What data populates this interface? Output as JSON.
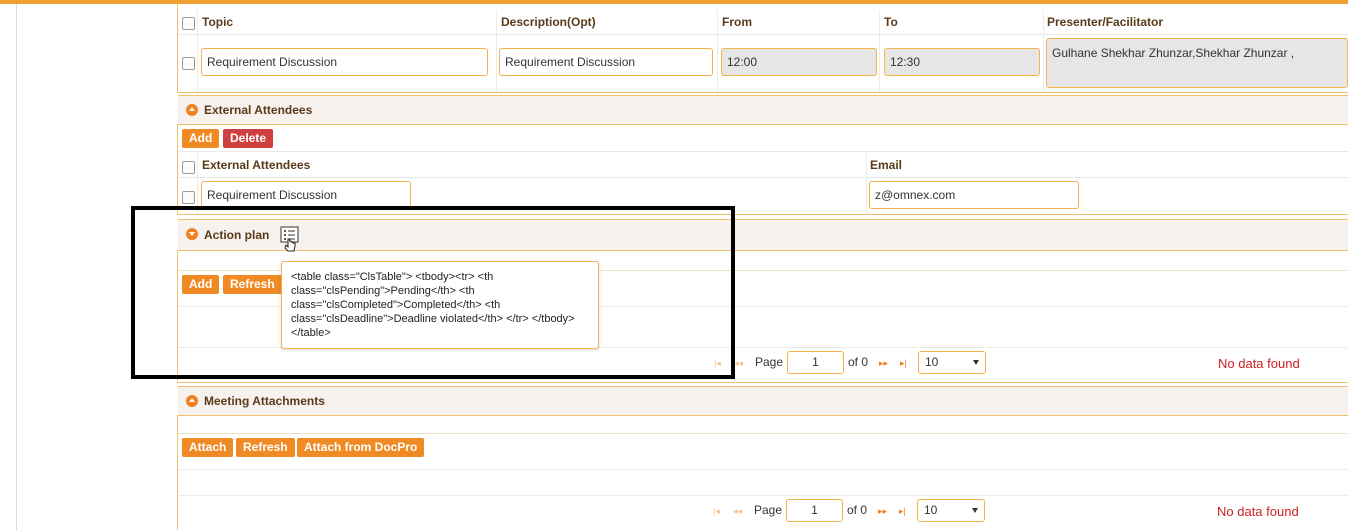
{
  "topic_table": {
    "headers": [
      "Topic",
      "Description(Opt)",
      "From",
      "To",
      "Presenter/Facilitator"
    ],
    "row": {
      "topic": "Requirement Discussion",
      "description": "Requirement Discussion",
      "from": "12:00",
      "to": "12:30",
      "presenter": "Gulhane Shekhar Zhunzar,Shekhar Zhunzar ,"
    }
  },
  "external_attendees": {
    "title": "External Attendees",
    "add_label": "Add",
    "delete_label": "Delete",
    "headers": [
      "External Attendees",
      "Email"
    ],
    "row": {
      "name": "Requirement Discussion",
      "email": "z@omnex.com"
    }
  },
  "action_plan": {
    "title": "Action plan",
    "add_label": "Add",
    "refresh_label": "Refresh",
    "tooltip": "<table class=\"ClsTable\"> <tbody><tr> <th class=\"clsPending\">Pending</th> <th class=\"clsCompleted\">Completed</th> <th class=\"clsDeadline\">Deadline violated</th> </tr> </tbody></table>",
    "pager": {
      "page_label": "Page",
      "page": "1",
      "of_label": "of 0",
      "page_size": "10",
      "no_data": "No data found"
    }
  },
  "meeting_attachments": {
    "title": "Meeting Attachments",
    "attach_label": "Attach",
    "refresh_label": "Refresh",
    "docpro_label": "Attach from DocPro",
    "pager": {
      "page_label": "Page",
      "page": "1",
      "of_label": "of 0",
      "page_size": "10",
      "no_data": "No data found"
    }
  },
  "colors": {
    "accent": "#f08a24",
    "danger": "#cf4040",
    "border": "#f2b34a",
    "nodata": "#d02020"
  }
}
